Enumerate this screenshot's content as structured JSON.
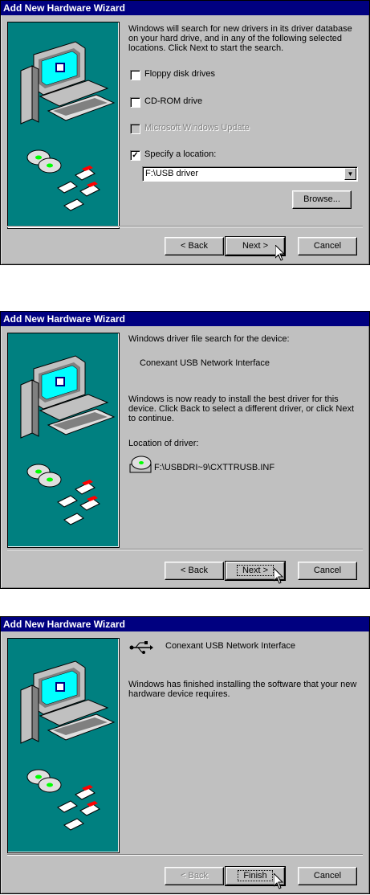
{
  "dialogs": [
    {
      "title": "Add New Hardware Wizard",
      "intro": "Windows will search for new drivers in its driver database on your hard drive, and in any of the following selected locations. Click Next to start the search.",
      "options": [
        {
          "label": "Floppy disk drives",
          "checked": false,
          "enabled": true
        },
        {
          "label": "CD-ROM drive",
          "checked": false,
          "enabled": true
        },
        {
          "label": "Microsoft Windows Update",
          "checked": false,
          "enabled": false
        },
        {
          "label": "Specify a location:",
          "checked": true,
          "enabled": true
        }
      ],
      "location_value": "F:\\USB driver",
      "browse_label": "Browse...",
      "back_label": "< Back",
      "next_label": "Next >",
      "cancel_label": "Cancel"
    },
    {
      "title": "Add New Hardware Wizard",
      "search_heading": "Windows driver file search for the device:",
      "device_name": "Conexant USB Network Interface",
      "ready_text": "Windows is now ready to install the best driver for this device. Click Back to select a different driver, or click Next to continue.",
      "location_heading": "Location of driver:",
      "driver_path": "F:\\USBDRI~9\\CXTTRUSB.INF",
      "back_label": "< Back",
      "next_label": "Next >",
      "cancel_label": "Cancel"
    },
    {
      "title": "Add New Hardware Wizard",
      "device_name": "Conexant USB Network Interface",
      "finished_text": "Windows has finished installing the software that your new hardware device requires.",
      "back_label": "< Back",
      "finish_label": "Finish",
      "cancel_label": "Cancel"
    }
  ]
}
